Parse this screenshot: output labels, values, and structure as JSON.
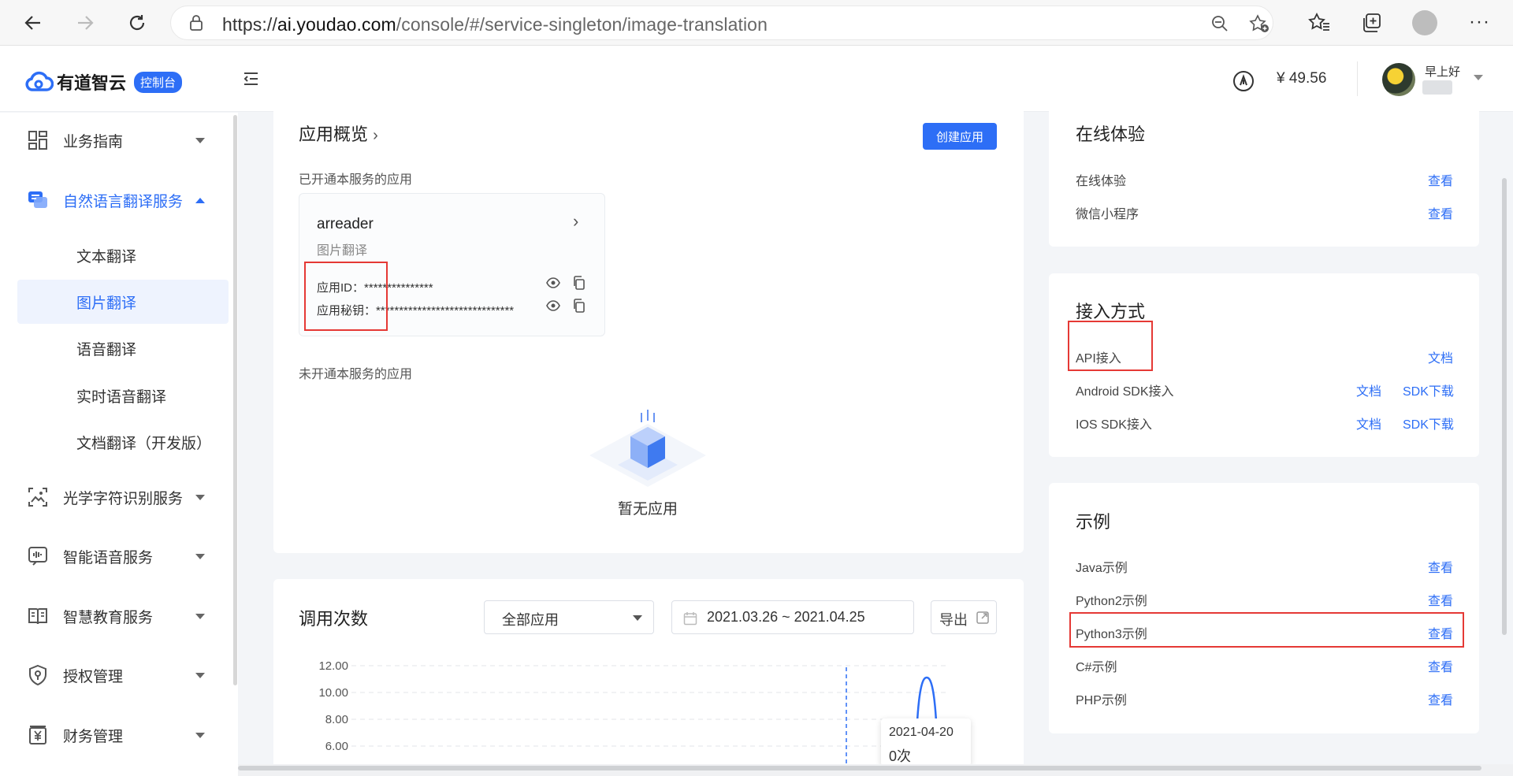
{
  "browser": {
    "url_prefix": "https://",
    "url_host": "ai.youdao.com",
    "url_path": "/console/#/service-singleton/image-translation"
  },
  "header": {
    "logo_text": "有道智云",
    "console_badge": "控制台",
    "balance": "¥ 49.56",
    "greeting": "早上好"
  },
  "sidebar": {
    "items": [
      {
        "label": "业务指南"
      },
      {
        "label": "自然语言翻译服务"
      },
      {
        "label": "光学字符识别服务"
      },
      {
        "label": "智能语音服务"
      },
      {
        "label": "智慧教育服务"
      },
      {
        "label": "授权管理"
      },
      {
        "label": "财务管理"
      }
    ],
    "sub_items": [
      {
        "label": "文本翻译"
      },
      {
        "label": "图片翻译"
      },
      {
        "label": "语音翻译"
      },
      {
        "label": "实时语音翻译"
      },
      {
        "label": "文档翻译（开发版）"
      }
    ]
  },
  "overview": {
    "title": "应用概览",
    "create_button": "创建应用",
    "opened_label": "已开通本服务的应用",
    "app_name": "arreader",
    "app_type": "图片翻译",
    "app_id_label": "应用ID：",
    "app_id_value": "***************",
    "app_secret_label": "应用秘钥：",
    "app_secret_value": "******************************",
    "not_opened_label": "未开通本服务的应用",
    "empty_text": "暂无应用"
  },
  "usage": {
    "title": "调用次数",
    "app_select": "全部应用",
    "date_range": "2021.03.26 ~ 2021.04.25",
    "export_label": "导出",
    "tooltip_date": "2021-04-20",
    "tooltip_value": "0次"
  },
  "chart_data": {
    "type": "line",
    "y_ticks": [
      "12.00",
      "10.00",
      "8.00",
      "6.00"
    ],
    "ylim": [
      6,
      12
    ],
    "grid": true,
    "highlighted_x": "2021-04-20",
    "highlighted_value": 0
  },
  "online": {
    "title": "在线体验",
    "rows": [
      {
        "label": "在线体验",
        "link": "查看"
      },
      {
        "label": "微信小程序",
        "link": "查看"
      }
    ]
  },
  "access": {
    "title": "接入方式",
    "rows": [
      {
        "label": "API接入",
        "doc": "文档",
        "sdk": ""
      },
      {
        "label": "Android SDK接入",
        "doc": "文档",
        "sdk": "SDK下载"
      },
      {
        "label": "IOS SDK接入",
        "doc": "文档",
        "sdk": "SDK下载"
      }
    ]
  },
  "examples": {
    "title": "示例",
    "rows": [
      {
        "label": "Java示例",
        "link": "查看"
      },
      {
        "label": "Python2示例",
        "link": "查看"
      },
      {
        "label": "Python3示例",
        "link": "查看"
      },
      {
        "label": "C#示例",
        "link": "查看"
      },
      {
        "label": "PHP示例",
        "link": "查看"
      }
    ]
  },
  "colors": {
    "accent": "#2d6ef6",
    "highlight_frame": "#e53935"
  }
}
